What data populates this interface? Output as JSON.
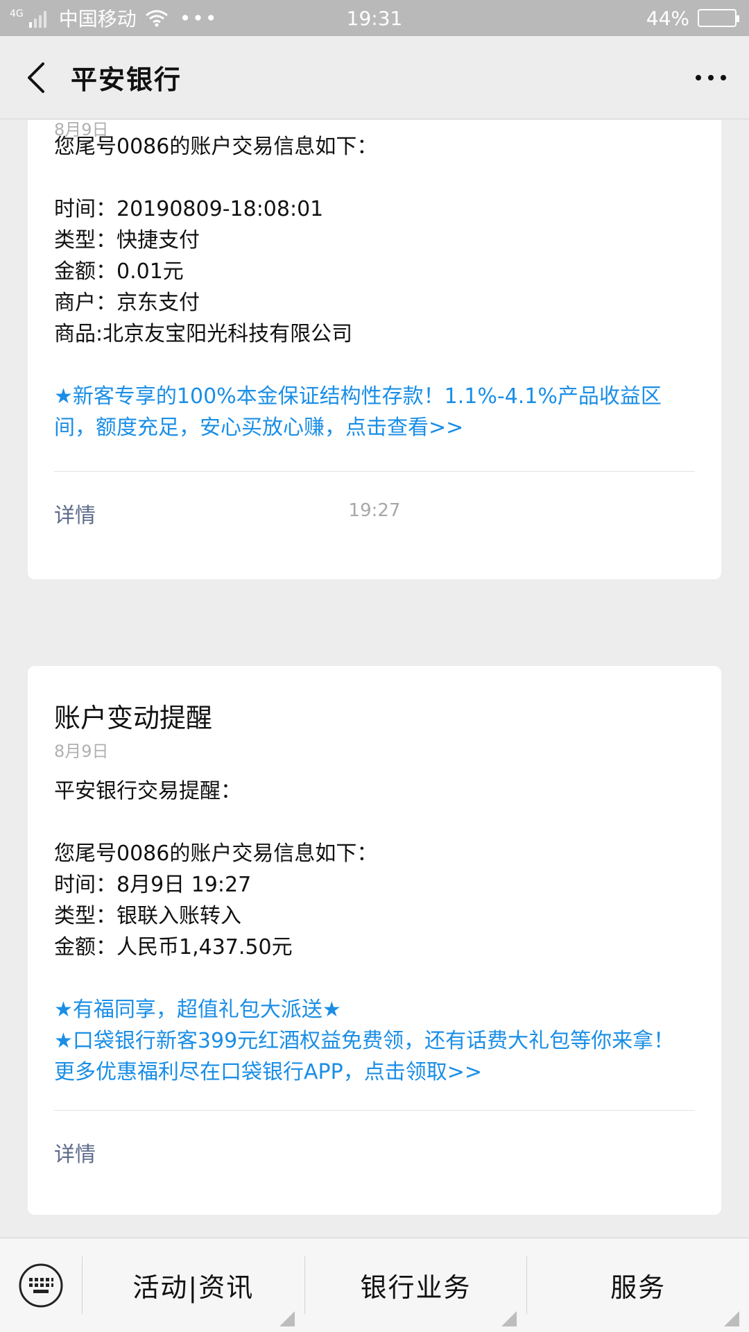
{
  "status_bar": {
    "network": "4G",
    "carrier": "中国移动",
    "dots": "•••",
    "time": "19:31",
    "battery": "44%",
    "battery_level": 0.44
  },
  "nav": {
    "title": "平安银行"
  },
  "card1": {
    "cut_date": "8月9日",
    "intro": "您尾号0086的账户交易信息如下：",
    "lines": [
      "时间：20190809-18:08:01",
      "类型：快捷支付",
      "金额：0.01元",
      "商户：京东支付",
      "商品:北京友宝阳光科技有限公司"
    ],
    "promo": "★新客专享的100%本金保证结构性存款！1.1%-4.1%产品收益区间，额度充足，安心买放心赚，点击查看>>",
    "detail": "详情"
  },
  "timestamp": "19:27",
  "card2": {
    "title": "账户变动提醒",
    "date": "8月9日",
    "greeting": "平安银行交易提醒：",
    "lines": [
      "您尾号0086的账户交易信息如下：",
      "时间：8月9日 19:27",
      "类型：银联入账转入",
      "金额：人民币1,437.50元"
    ],
    "promo_lines": [
      "★有福同享，超值礼包大派送★",
      "★口袋银行新客399元红酒权益免费领，还有话费大礼包等你来拿！更多优惠福利尽在口袋银行APP，点击领取>>"
    ],
    "detail": "详情"
  },
  "bottom_menu": {
    "items": [
      "活动|资讯",
      "银行业务",
      "服务"
    ]
  },
  "colors": {
    "promo_link": "#1a8ee6",
    "detail_link": "#5d6b8a",
    "status_bar": "#b9b9b9"
  }
}
